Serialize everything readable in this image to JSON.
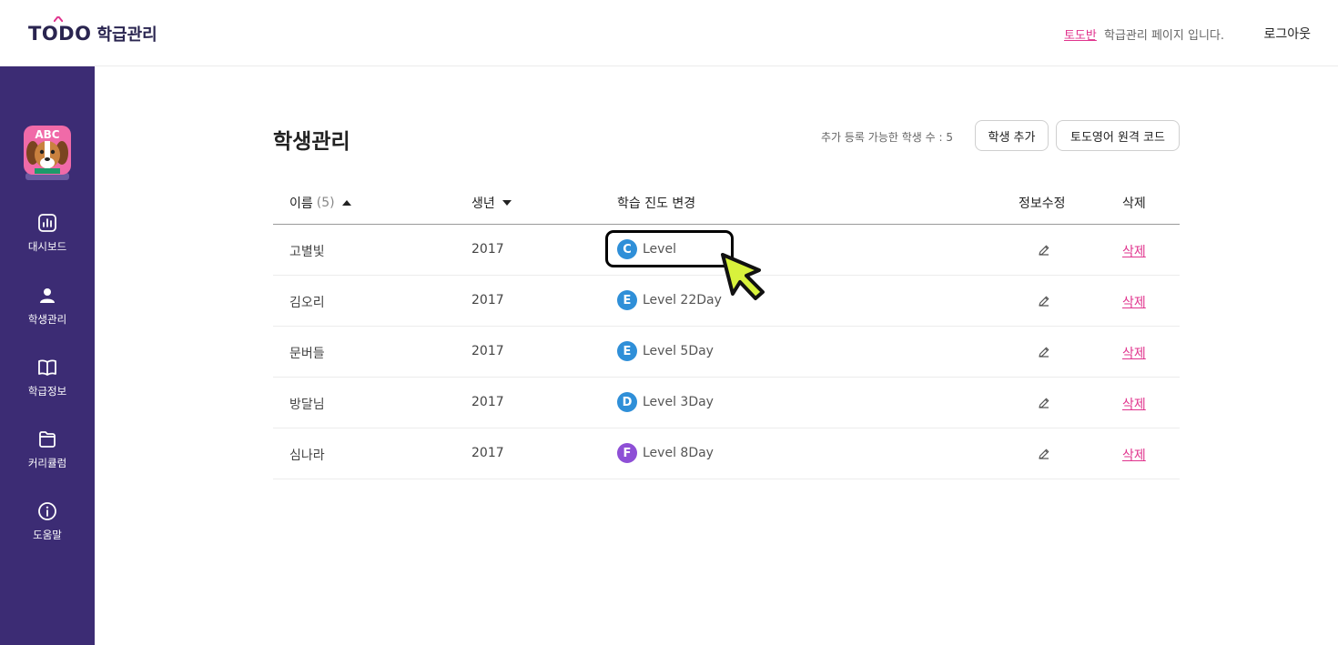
{
  "header": {
    "logo_main": "TODO",
    "logo_sub": "학급관리",
    "class_name": "토도반",
    "info_text": "학급관리 페이지 입니다.",
    "logout": "로그아웃"
  },
  "sidebar": {
    "avatar_text": "ABC",
    "items": [
      {
        "label": "대시보드",
        "icon": "dashboard-chart-icon"
      },
      {
        "label": "학생관리",
        "icon": "person-icon"
      },
      {
        "label": "학급정보",
        "icon": "book-icon"
      },
      {
        "label": "커리큘럼",
        "icon": "folder-icon"
      },
      {
        "label": "도움말",
        "icon": "info-icon"
      }
    ]
  },
  "main": {
    "title": "학생관리",
    "capacity_label": "추가 등록 가능한 학생 수 : 5",
    "add_button": "학생 추가",
    "code_button": "토도영어 원격 코드"
  },
  "table": {
    "columns": {
      "name": "이름",
      "count": "(5)",
      "birth": "생년",
      "progress": "학습 진도 변경",
      "edit": "정보수정",
      "delete": "삭제"
    },
    "rows": [
      {
        "name": "고별빛",
        "birth": "2017",
        "badge": "C",
        "badge_color": "#2f8fd8",
        "level": "Level",
        "delete": "삭제"
      },
      {
        "name": "김오리",
        "birth": "2017",
        "badge": "E",
        "badge_color": "#2f8fd8",
        "level": "Level 22Day",
        "delete": "삭제"
      },
      {
        "name": "문버들",
        "birth": "2017",
        "badge": "E",
        "badge_color": "#2f8fd8",
        "level": "Level 5Day",
        "delete": "삭제"
      },
      {
        "name": "방달님",
        "birth": "2017",
        "badge": "D",
        "badge_color": "#2f8fd8",
        "level": "Level 3Day",
        "delete": "삭제"
      },
      {
        "name": "심나라",
        "birth": "2017",
        "badge": "F",
        "badge_color": "#8e4fd6",
        "level": "Level 8Day",
        "delete": "삭제"
      }
    ]
  },
  "colors": {
    "sidebar_bg": "#3c2c74",
    "accent_pink": "#e0338d",
    "pointer_fill": "#d8f23c"
  }
}
